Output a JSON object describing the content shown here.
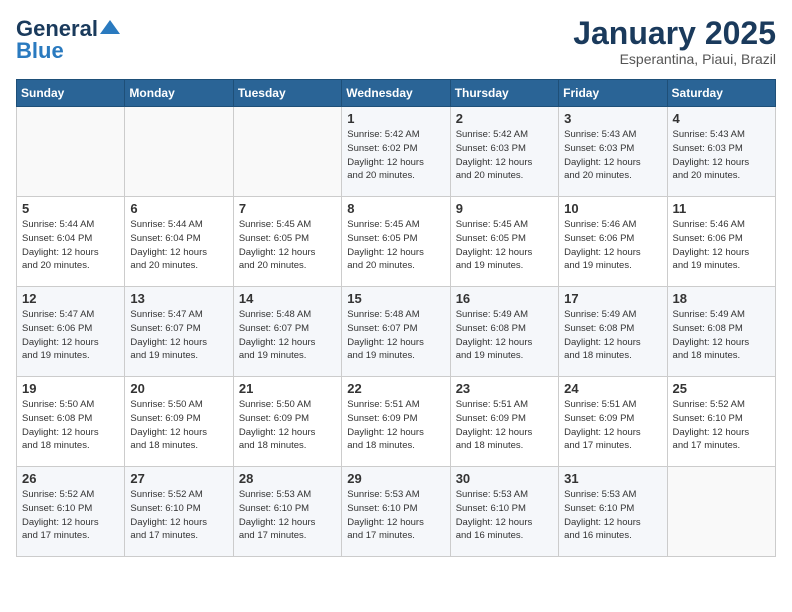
{
  "logo": {
    "line1": "General",
    "line2": "Blue"
  },
  "title": "January 2025",
  "subtitle": "Esperantina, Piaui, Brazil",
  "weekdays": [
    "Sunday",
    "Monday",
    "Tuesday",
    "Wednesday",
    "Thursday",
    "Friday",
    "Saturday"
  ],
  "weeks": [
    [
      {
        "day": "",
        "info": ""
      },
      {
        "day": "",
        "info": ""
      },
      {
        "day": "",
        "info": ""
      },
      {
        "day": "1",
        "info": "Sunrise: 5:42 AM\nSunset: 6:02 PM\nDaylight: 12 hours\nand 20 minutes."
      },
      {
        "day": "2",
        "info": "Sunrise: 5:42 AM\nSunset: 6:03 PM\nDaylight: 12 hours\nand 20 minutes."
      },
      {
        "day": "3",
        "info": "Sunrise: 5:43 AM\nSunset: 6:03 PM\nDaylight: 12 hours\nand 20 minutes."
      },
      {
        "day": "4",
        "info": "Sunrise: 5:43 AM\nSunset: 6:03 PM\nDaylight: 12 hours\nand 20 minutes."
      }
    ],
    [
      {
        "day": "5",
        "info": "Sunrise: 5:44 AM\nSunset: 6:04 PM\nDaylight: 12 hours\nand 20 minutes."
      },
      {
        "day": "6",
        "info": "Sunrise: 5:44 AM\nSunset: 6:04 PM\nDaylight: 12 hours\nand 20 minutes."
      },
      {
        "day": "7",
        "info": "Sunrise: 5:45 AM\nSunset: 6:05 PM\nDaylight: 12 hours\nand 20 minutes."
      },
      {
        "day": "8",
        "info": "Sunrise: 5:45 AM\nSunset: 6:05 PM\nDaylight: 12 hours\nand 20 minutes."
      },
      {
        "day": "9",
        "info": "Sunrise: 5:45 AM\nSunset: 6:05 PM\nDaylight: 12 hours\nand 19 minutes."
      },
      {
        "day": "10",
        "info": "Sunrise: 5:46 AM\nSunset: 6:06 PM\nDaylight: 12 hours\nand 19 minutes."
      },
      {
        "day": "11",
        "info": "Sunrise: 5:46 AM\nSunset: 6:06 PM\nDaylight: 12 hours\nand 19 minutes."
      }
    ],
    [
      {
        "day": "12",
        "info": "Sunrise: 5:47 AM\nSunset: 6:06 PM\nDaylight: 12 hours\nand 19 minutes."
      },
      {
        "day": "13",
        "info": "Sunrise: 5:47 AM\nSunset: 6:07 PM\nDaylight: 12 hours\nand 19 minutes."
      },
      {
        "day": "14",
        "info": "Sunrise: 5:48 AM\nSunset: 6:07 PM\nDaylight: 12 hours\nand 19 minutes."
      },
      {
        "day": "15",
        "info": "Sunrise: 5:48 AM\nSunset: 6:07 PM\nDaylight: 12 hours\nand 19 minutes."
      },
      {
        "day": "16",
        "info": "Sunrise: 5:49 AM\nSunset: 6:08 PM\nDaylight: 12 hours\nand 19 minutes."
      },
      {
        "day": "17",
        "info": "Sunrise: 5:49 AM\nSunset: 6:08 PM\nDaylight: 12 hours\nand 18 minutes."
      },
      {
        "day": "18",
        "info": "Sunrise: 5:49 AM\nSunset: 6:08 PM\nDaylight: 12 hours\nand 18 minutes."
      }
    ],
    [
      {
        "day": "19",
        "info": "Sunrise: 5:50 AM\nSunset: 6:08 PM\nDaylight: 12 hours\nand 18 minutes."
      },
      {
        "day": "20",
        "info": "Sunrise: 5:50 AM\nSunset: 6:09 PM\nDaylight: 12 hours\nand 18 minutes."
      },
      {
        "day": "21",
        "info": "Sunrise: 5:50 AM\nSunset: 6:09 PM\nDaylight: 12 hours\nand 18 minutes."
      },
      {
        "day": "22",
        "info": "Sunrise: 5:51 AM\nSunset: 6:09 PM\nDaylight: 12 hours\nand 18 minutes."
      },
      {
        "day": "23",
        "info": "Sunrise: 5:51 AM\nSunset: 6:09 PM\nDaylight: 12 hours\nand 18 minutes."
      },
      {
        "day": "24",
        "info": "Sunrise: 5:51 AM\nSunset: 6:09 PM\nDaylight: 12 hours\nand 17 minutes."
      },
      {
        "day": "25",
        "info": "Sunrise: 5:52 AM\nSunset: 6:10 PM\nDaylight: 12 hours\nand 17 minutes."
      }
    ],
    [
      {
        "day": "26",
        "info": "Sunrise: 5:52 AM\nSunset: 6:10 PM\nDaylight: 12 hours\nand 17 minutes."
      },
      {
        "day": "27",
        "info": "Sunrise: 5:52 AM\nSunset: 6:10 PM\nDaylight: 12 hours\nand 17 minutes."
      },
      {
        "day": "28",
        "info": "Sunrise: 5:53 AM\nSunset: 6:10 PM\nDaylight: 12 hours\nand 17 minutes."
      },
      {
        "day": "29",
        "info": "Sunrise: 5:53 AM\nSunset: 6:10 PM\nDaylight: 12 hours\nand 17 minutes."
      },
      {
        "day": "30",
        "info": "Sunrise: 5:53 AM\nSunset: 6:10 PM\nDaylight: 12 hours\nand 16 minutes."
      },
      {
        "day": "31",
        "info": "Sunrise: 5:53 AM\nSunset: 6:10 PM\nDaylight: 12 hours\nand 16 minutes."
      },
      {
        "day": "",
        "info": ""
      }
    ]
  ]
}
